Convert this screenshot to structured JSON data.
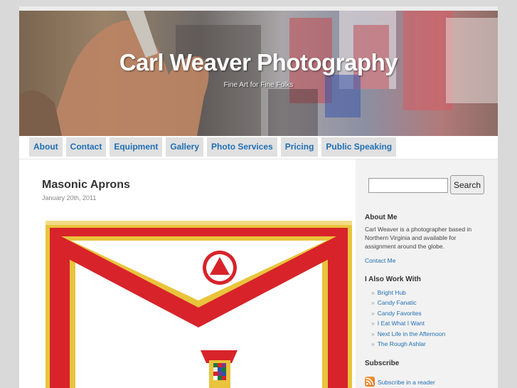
{
  "site": {
    "title": "Carl Weaver Photography",
    "tagline": "Fine Art for Fine Folks"
  },
  "nav": {
    "items": [
      {
        "label": "About"
      },
      {
        "label": "Contact"
      },
      {
        "label": "Equipment"
      },
      {
        "label": "Gallery"
      },
      {
        "label": "Photo Services"
      },
      {
        "label": "Pricing"
      },
      {
        "label": "Public Speaking"
      }
    ]
  },
  "post": {
    "title": "Masonic Aprons",
    "date": "January 20th, 2011"
  },
  "sidebar": {
    "search": {
      "value": "",
      "button_label": "Search"
    },
    "about": {
      "title": "About Me",
      "text": "Carl Weaver is a photographer based in Northern Virginia and available for assignment around the globe.",
      "link": "Contact Me"
    },
    "also_work": {
      "title": "I Also Work With",
      "links": [
        "Bright Hub",
        "Candy Fanatic",
        "Candy Favorites",
        "I Eat What I Want",
        "Next Life in the Afternoon",
        "The Rough Ashlar"
      ]
    },
    "subscribe": {
      "title": "Subscribe",
      "link": "Subscribe in a reader"
    }
  },
  "colors": {
    "link": "#1f6fb5",
    "nav_bg": "#e0e0e0",
    "sidebar_bg": "#f2f2f2",
    "apron_red": "#d8232a",
    "apron_gold": "#e9c43c"
  },
  "icons": {
    "bullet": "»",
    "rss": "rss-feed-icon"
  }
}
